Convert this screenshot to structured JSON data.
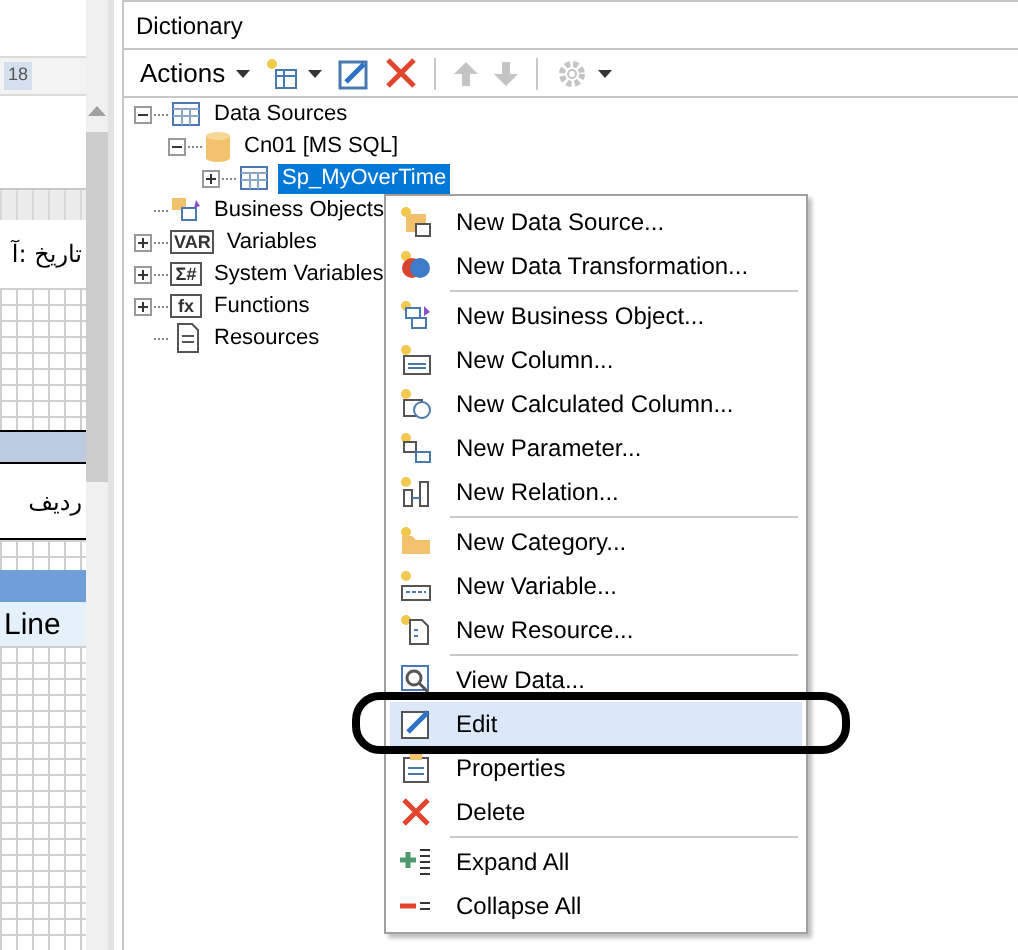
{
  "designer": {
    "ruler_label": "18",
    "texts": [
      "تاريخ :آ",
      "رديف",
      "Line"
    ]
  },
  "dictionary": {
    "title": "Dictionary",
    "toolbar": [
      {
        "kind": "actions",
        "label": "Actions",
        "disabled": false
      },
      {
        "kind": "new",
        "disabled": false
      },
      {
        "kind": "edit",
        "disabled": false
      },
      {
        "kind": "delete",
        "disabled": false
      },
      {
        "kind": "separator"
      },
      {
        "kind": "up",
        "disabled": true
      },
      {
        "kind": "down",
        "disabled": true
      },
      {
        "kind": "separator"
      },
      {
        "kind": "settings",
        "disabled": true
      }
    ],
    "tree": [
      {
        "label": "Data Sources",
        "kind": "table",
        "expanded": true,
        "selected": false,
        "children": [
          {
            "label": "Cn01 [MS SQL]",
            "kind": "database",
            "expanded": true,
            "selected": false,
            "children": [
              {
                "label": "Sp_MyOverTime",
                "kind": "table",
                "expanded": false,
                "selected": true
              }
            ]
          }
        ]
      },
      {
        "label": "Business Objects",
        "kind": "objects",
        "selected": false
      },
      {
        "label": "Variables",
        "kind": "glyph",
        "glyph": "VAR",
        "expanded": false,
        "selected": false
      },
      {
        "label": "System Variables",
        "kind": "glyph",
        "glyph": "Σ#",
        "expanded": false,
        "selected": false
      },
      {
        "label": "Functions",
        "kind": "glyph",
        "glyph": "fx",
        "expanded": false,
        "selected": false
      },
      {
        "label": "Resources",
        "kind": "document",
        "selected": false
      }
    ]
  },
  "context_menu": [
    {
      "kind": "item",
      "label": "New Data Source...",
      "selected": false
    },
    {
      "kind": "item",
      "label": "New Data Transformation...",
      "selected": false
    },
    {
      "kind": "separator"
    },
    {
      "kind": "item",
      "label": "New Business Object...",
      "selected": false
    },
    {
      "kind": "item",
      "label": "New Column...",
      "selected": false
    },
    {
      "kind": "item",
      "label": "New Calculated Column...",
      "selected": false
    },
    {
      "kind": "item",
      "label": "New Parameter...",
      "selected": false
    },
    {
      "kind": "item",
      "label": "New Relation...",
      "selected": false
    },
    {
      "kind": "separator"
    },
    {
      "kind": "item",
      "label": "New Category...",
      "selected": false
    },
    {
      "kind": "item",
      "label": "New Variable...",
      "selected": false
    },
    {
      "kind": "item",
      "label": "New Resource...",
      "selected": false
    },
    {
      "kind": "separator"
    },
    {
      "kind": "item",
      "label": "View Data...",
      "selected": false
    },
    {
      "kind": "item",
      "label": "Edit",
      "selected": true
    },
    {
      "kind": "item",
      "label": "Properties",
      "selected": false
    },
    {
      "kind": "item",
      "label": "Delete",
      "selected": false
    },
    {
      "kind": "separator"
    },
    {
      "kind": "item",
      "label": "Expand All",
      "selected": false
    },
    {
      "kind": "item",
      "label": "Collapse All",
      "selected": false
    }
  ]
}
